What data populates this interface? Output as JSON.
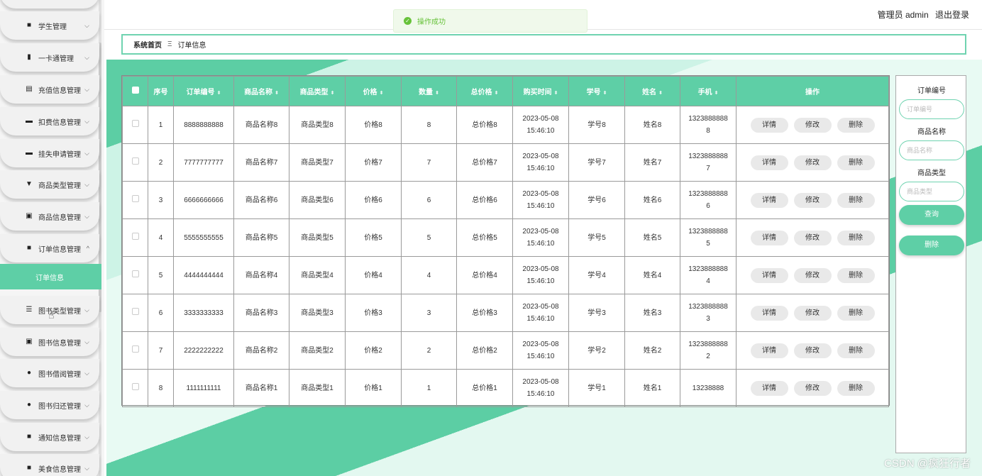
{
  "sidebar": {
    "items": [
      {
        "label": "",
        "icon": "menu-icon"
      },
      {
        "label": "学生管理",
        "icon": "grid-icon"
      },
      {
        "label": "一卡通管理",
        "icon": "card-icon"
      },
      {
        "label": "充值信息管理",
        "icon": "clipboard-icon"
      },
      {
        "label": "扣费信息管理",
        "icon": "message-icon"
      },
      {
        "label": "挂失申请管理",
        "icon": "monitor-icon"
      },
      {
        "label": "商品类型管理",
        "icon": "trophy-icon"
      },
      {
        "label": "商品信息管理",
        "icon": "check-clipboard-icon"
      },
      {
        "label": "订单信息管理",
        "icon": "grid-icon"
      },
      {
        "label": "图书类型管理",
        "icon": "list-icon"
      },
      {
        "label": "图书信息管理",
        "icon": "delete-clipboard-icon"
      },
      {
        "label": "图书借阅管理",
        "icon": "user-icon"
      },
      {
        "label": "图书归还管理",
        "icon": "user-icon"
      },
      {
        "label": "通知信息管理",
        "icon": "grid-icon"
      },
      {
        "label": "美食信息管理",
        "icon": "grid-icon"
      }
    ],
    "active_sub": "订单信息"
  },
  "header": {
    "user_role": "管理员 admin",
    "logout": "退出登录"
  },
  "toast": {
    "message": "操作成功"
  },
  "breadcrumb": {
    "home": "系统首页",
    "sep": "Ξ",
    "current": "订单信息"
  },
  "table": {
    "headers": [
      "序号",
      "订单编号",
      "商品名称",
      "商品类型",
      "价格",
      "数量",
      "总价格",
      "购买时间",
      "学号",
      "姓名",
      "手机",
      "操作"
    ],
    "rows": [
      {
        "no": "1",
        "order_no": "8888888888",
        "name": "商品名称8",
        "type": "商品类型8",
        "price": "价格8",
        "qty": "8",
        "total": "总价格8",
        "date": "2023-05-08",
        "time": "15:46:10",
        "sid": "学号8",
        "sname": "姓名8",
        "phone1": "1323888888",
        "phone2": "8"
      },
      {
        "no": "2",
        "order_no": "7777777777",
        "name": "商品名称7",
        "type": "商品类型7",
        "price": "价格7",
        "qty": "7",
        "total": "总价格7",
        "date": "2023-05-08",
        "time": "15:46:10",
        "sid": "学号7",
        "sname": "姓名7",
        "phone1": "1323888888",
        "phone2": "7"
      },
      {
        "no": "3",
        "order_no": "6666666666",
        "name": "商品名称6",
        "type": "商品类型6",
        "price": "价格6",
        "qty": "6",
        "total": "总价格6",
        "date": "2023-05-08",
        "time": "15:46:10",
        "sid": "学号6",
        "sname": "姓名6",
        "phone1": "1323888888",
        "phone2": "6"
      },
      {
        "no": "4",
        "order_no": "5555555555",
        "name": "商品名称5",
        "type": "商品类型5",
        "price": "价格5",
        "qty": "5",
        "total": "总价格5",
        "date": "2023-05-08",
        "time": "15:46:10",
        "sid": "学号5",
        "sname": "姓名5",
        "phone1": "1323888888",
        "phone2": "5"
      },
      {
        "no": "5",
        "order_no": "4444444444",
        "name": "商品名称4",
        "type": "商品类型4",
        "price": "价格4",
        "qty": "4",
        "total": "总价格4",
        "date": "2023-05-08",
        "time": "15:46:10",
        "sid": "学号4",
        "sname": "姓名4",
        "phone1": "1323888888",
        "phone2": "4"
      },
      {
        "no": "6",
        "order_no": "3333333333",
        "name": "商品名称3",
        "type": "商品类型3",
        "price": "价格3",
        "qty": "3",
        "total": "总价格3",
        "date": "2023-05-08",
        "time": "15:46:10",
        "sid": "学号3",
        "sname": "姓名3",
        "phone1": "1323888888",
        "phone2": "3"
      },
      {
        "no": "7",
        "order_no": "2222222222",
        "name": "商品名称2",
        "type": "商品类型2",
        "price": "价格2",
        "qty": "2",
        "total": "总价格2",
        "date": "2023-05-08",
        "time": "15:46:10",
        "sid": "学号2",
        "sname": "姓名2",
        "phone1": "1323888888",
        "phone2": "2"
      },
      {
        "no": "8",
        "order_no": "1111111111",
        "name": "商品名称1",
        "type": "商品类型1",
        "price": "价格1",
        "qty": "1",
        "total": "总价格1",
        "date": "2023-05-08",
        "time": "15:46:10",
        "sid": "学号1",
        "sname": "姓名1",
        "phone1": "13238888",
        "phone2": ""
      }
    ],
    "actions": {
      "detail": "详情",
      "edit": "修改",
      "delete": "删除"
    }
  },
  "search": {
    "order_label": "订单编号",
    "order_placeholder": "订单编号",
    "name_label": "商品名称",
    "name_placeholder": "商品名称",
    "type_label": "商品类型",
    "type_placeholder": "商品类型",
    "query": "查询",
    "delete": "删除"
  },
  "watermark": "CSDN @疯狂行者",
  "colors": {
    "accent": "#5ecfa6",
    "toast_bg": "#f0f9eb",
    "toast_text": "#67c23a"
  }
}
